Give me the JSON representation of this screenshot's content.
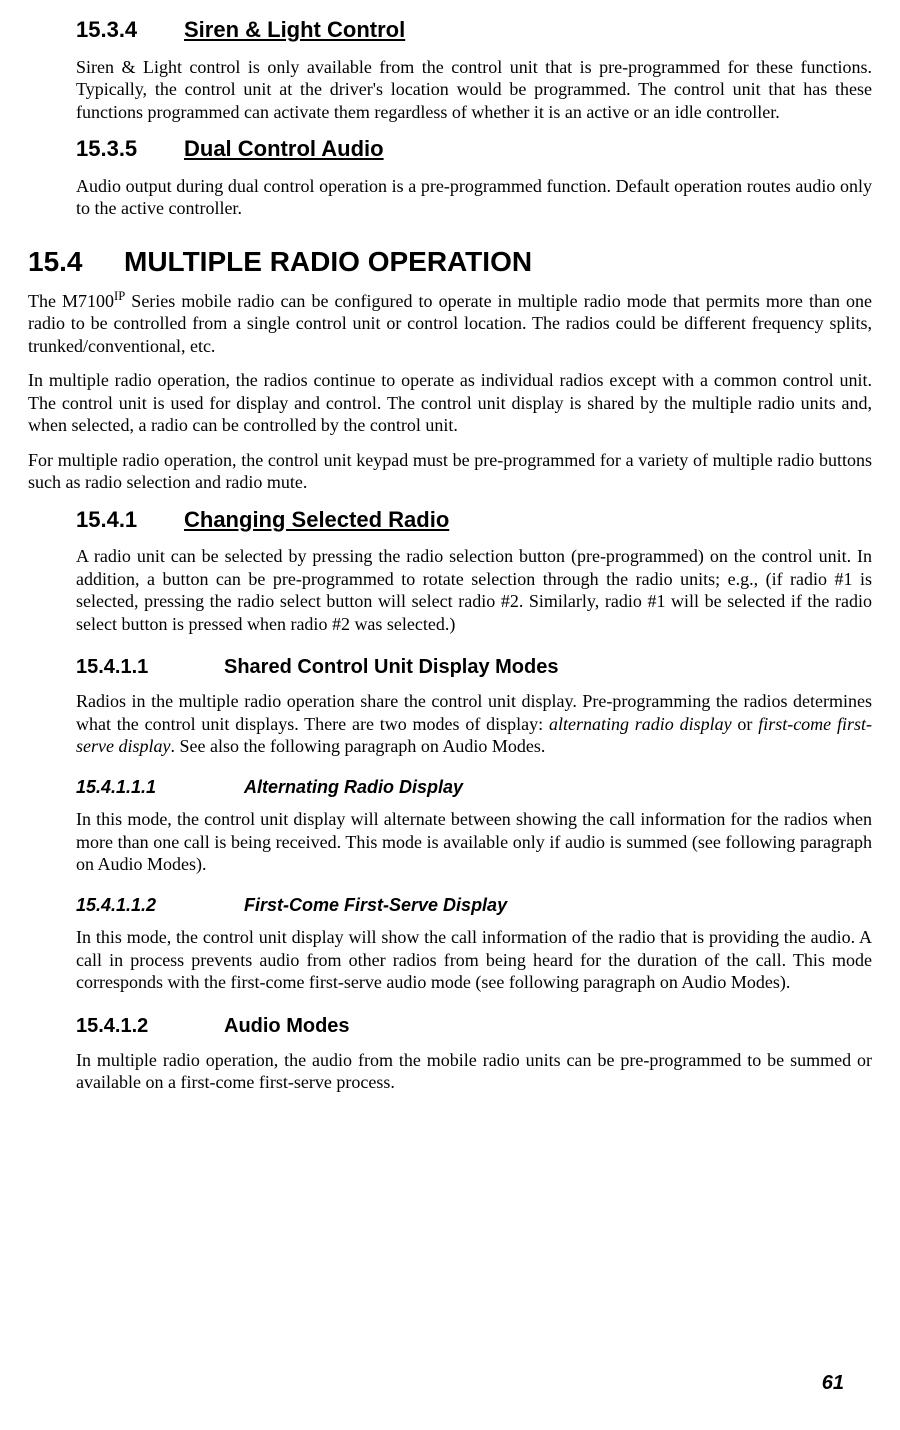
{
  "s1534": {
    "num": "15.3.4",
    "title": "Siren & Light Control",
    "p1": "Siren & Light control is only available from the control unit that is pre-programmed for these functions. Typically, the control unit at the driver's location would be programmed. The control unit that has these functions programmed can activate them regardless of whether it is an active or an idle controller."
  },
  "s1535": {
    "num": "15.3.5",
    "title": "Dual Control Audio",
    "p1": "Audio output during dual control operation is a pre-programmed function. Default operation routes audio only to the active controller."
  },
  "s154": {
    "num": "15.4",
    "title": "MULTIPLE RADIO OPERATION",
    "p1_a": "The M7100",
    "p1_sup": "IP",
    "p1_b": " Series mobile radio can be configured to operate in multiple radio mode that permits more than one radio to be controlled from a single control unit or control location. The radios could be different frequency splits, trunked/conventional, etc.",
    "p2": "In multiple radio operation, the radios continue to operate as individual radios except with a common control unit. The control unit is used for display and control. The control unit display is shared by the multiple radio units and, when selected, a radio can be controlled by the control unit.",
    "p3": "For multiple radio operation, the control unit keypad must be pre-programmed for a variety of multiple radio buttons such as radio selection and radio mute."
  },
  "s1541": {
    "num": "15.4.1",
    "title": "Changing Selected Radio",
    "p1": "A radio unit can be selected by pressing the radio selection button (pre-programmed) on the control unit.  In addition, a button can be pre-programmed to rotate selection through the radio units; e.g., (if radio #1 is selected, pressing the radio select button will select radio #2. Similarly, radio #1 will be selected if the radio select button is pressed when radio #2 was selected.)"
  },
  "s15411": {
    "num": "15.4.1.1",
    "title": "Shared Control Unit Display Modes",
    "p1_a": "Radios in the multiple radio operation share the control unit display. Pre-programming the radios determines what the control unit displays. There are two modes of display: ",
    "p1_i1": "alternating radio display",
    "p1_mid": " or ",
    "p1_i2": "first-come first-serve display",
    "p1_b": ". See also the following paragraph on Audio Modes."
  },
  "s154111": {
    "num": "15.4.1.1.1",
    "title": "Alternating Radio Display",
    "p1": "In this mode, the control unit display will alternate between showing the call information for the radios when more than one call is being received. This mode is available only if audio is summed (see following paragraph on Audio Modes)."
  },
  "s154112": {
    "num": "15.4.1.1.2",
    "title": "First-Come First-Serve Display",
    "p1": "In this mode, the control unit display will show the call information of the radio that is providing the audio. A call in process prevents audio from other radios from being heard for the duration of the call. This mode corresponds with the first-come first-serve audio mode (see following paragraph on Audio Modes)."
  },
  "s15412": {
    "num": "15.4.1.2",
    "title": "Audio Modes",
    "p1": "In multiple radio operation, the audio from the mobile radio units can be pre-programmed to be summed or available on a first-come first-serve process."
  },
  "page_number": "61"
}
